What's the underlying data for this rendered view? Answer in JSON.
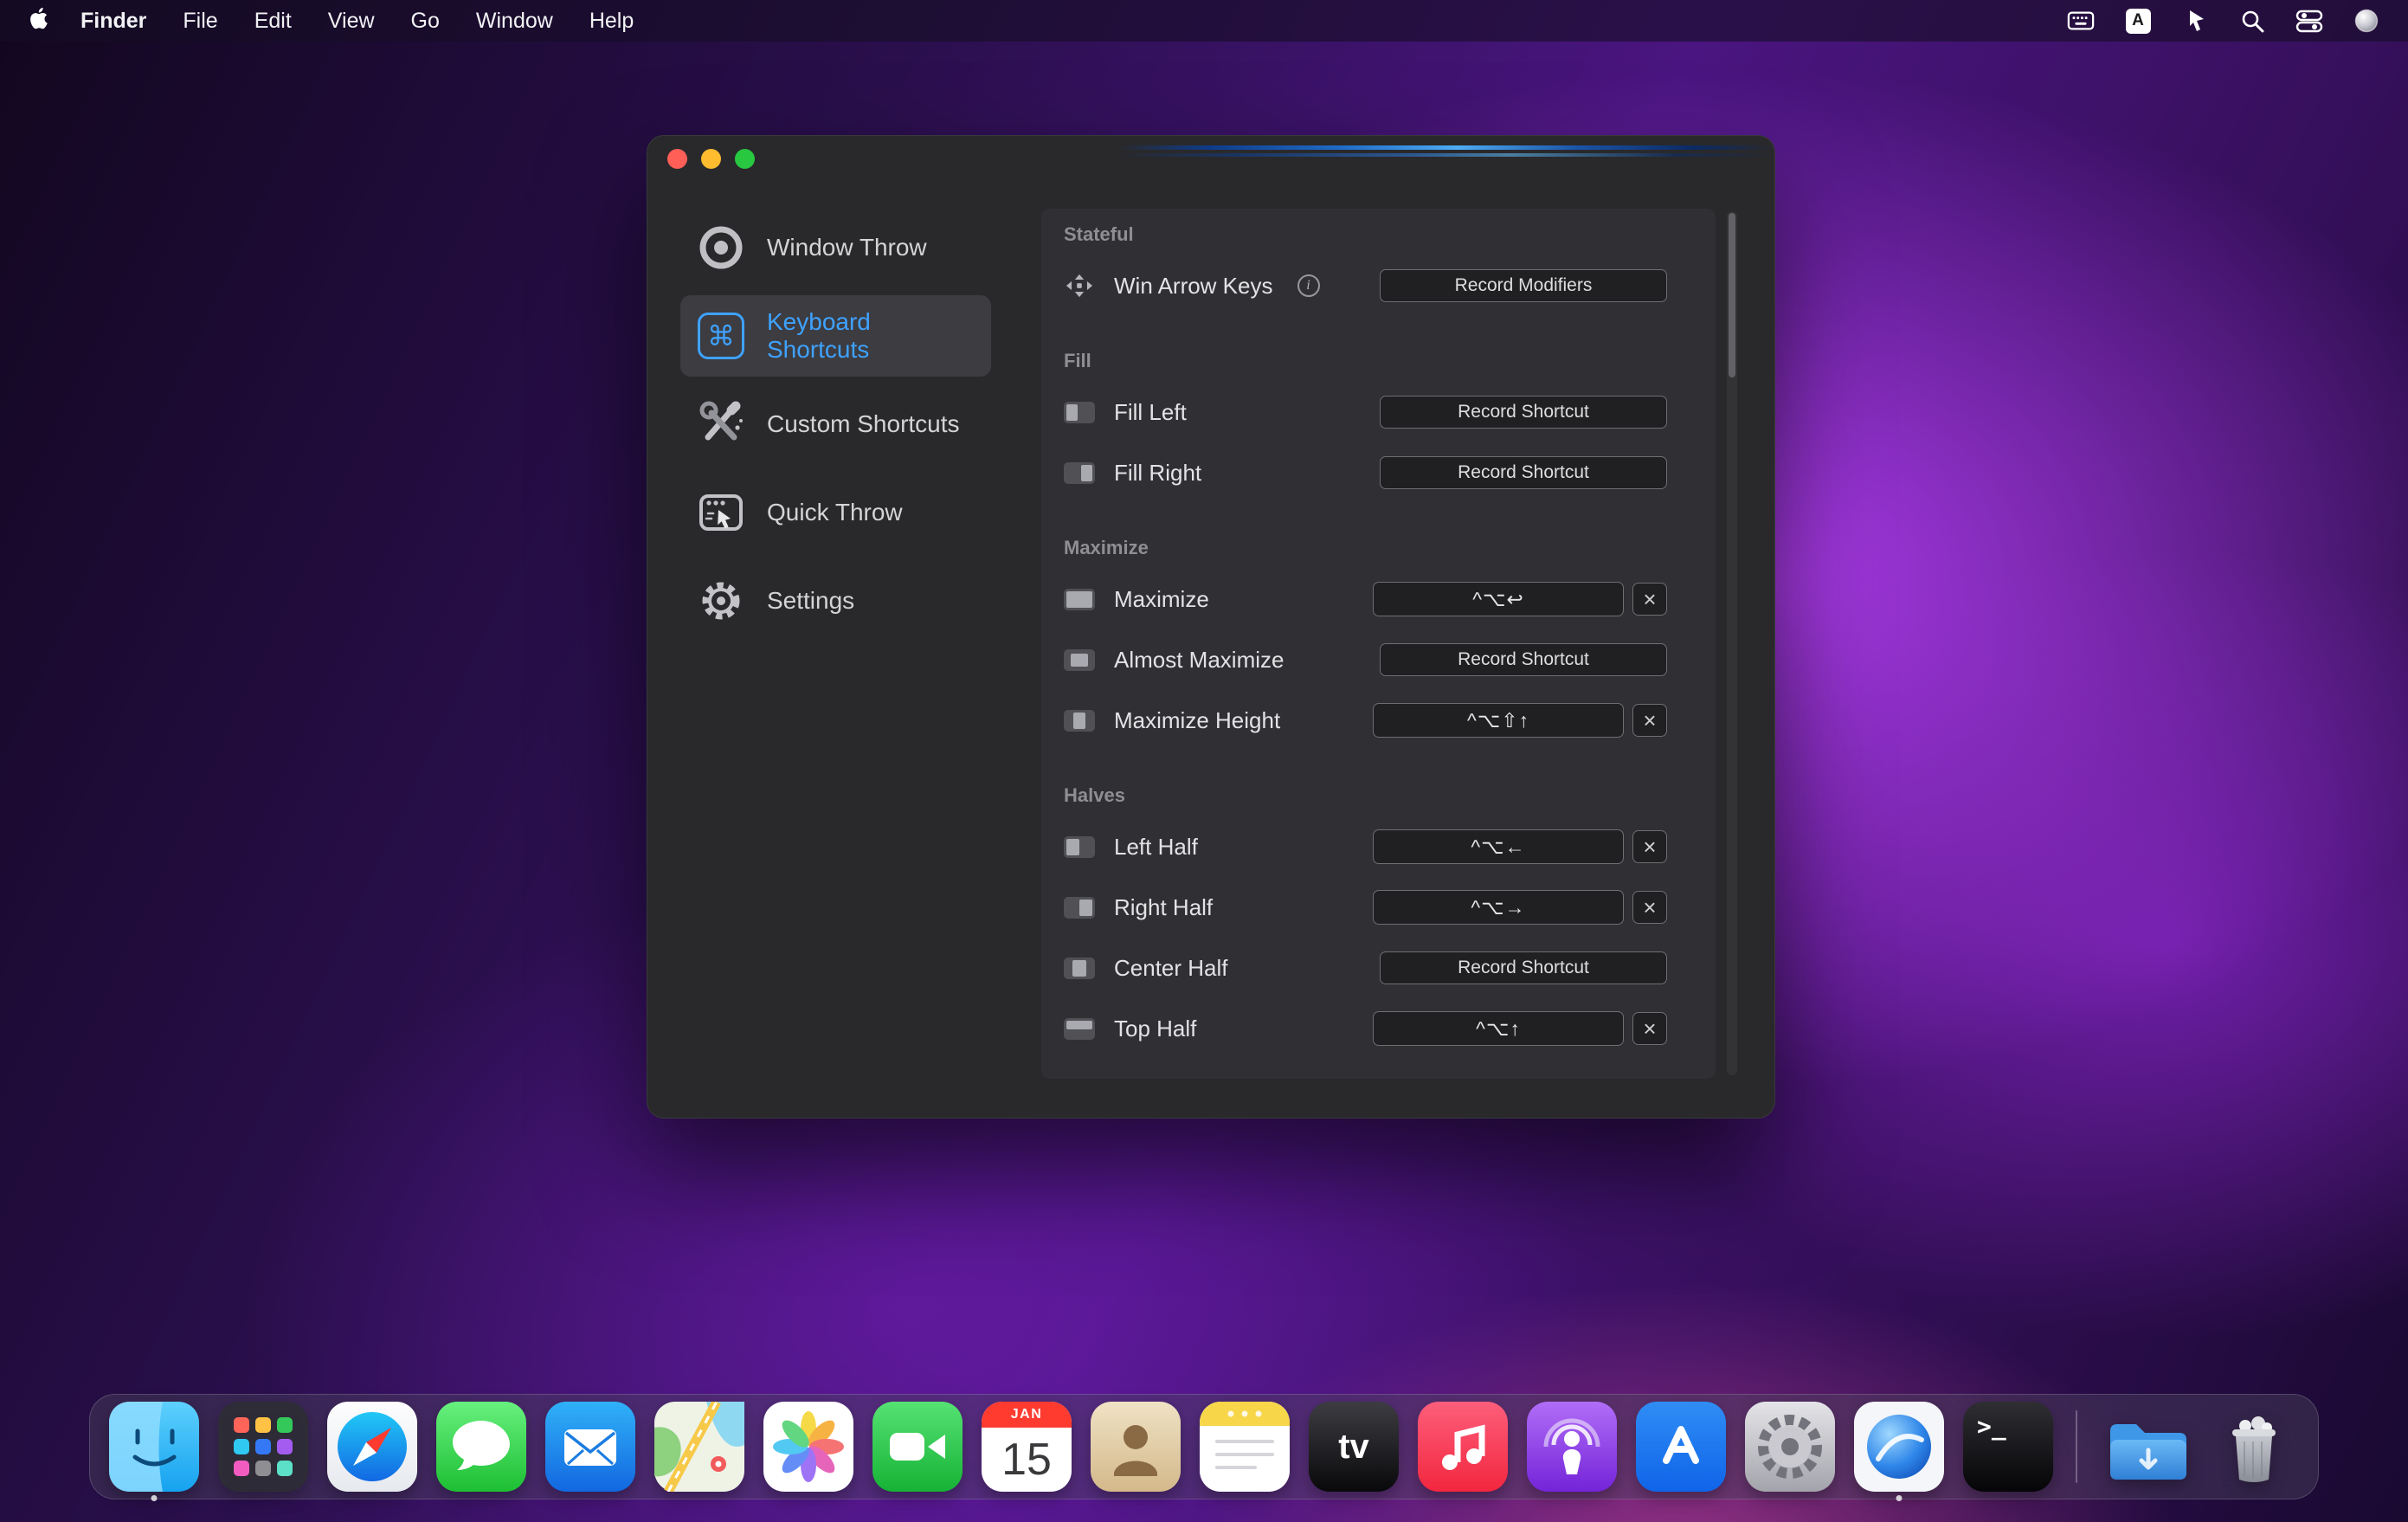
{
  "menu_bar": {
    "app_name": "Finder",
    "menus": [
      "File",
      "Edit",
      "View",
      "Go",
      "Window",
      "Help"
    ]
  },
  "glyphs": {
    "command": "⌘",
    "info": "i",
    "clear": "×",
    "tv": "tv",
    "terminal": ">_",
    "input": "A"
  },
  "window": {
    "sidebar": {
      "items": [
        {
          "label": "Window Throw"
        },
        {
          "label": "Keyboard Shortcuts"
        },
        {
          "label": "Custom Shortcuts"
        },
        {
          "label": "Quick Throw"
        },
        {
          "label": "Settings"
        }
      ]
    },
    "content": {
      "sections": [
        {
          "title": "Stateful",
          "rows": [
            {
              "label": "Win Arrow Keys",
              "button": "Record Modifiers"
            }
          ]
        },
        {
          "title": "Fill",
          "rows": [
            {
              "label": "Fill Left",
              "button": "Record Shortcut"
            },
            {
              "label": "Fill Right",
              "button": "Record Shortcut"
            }
          ]
        },
        {
          "title": "Maximize",
          "rows": [
            {
              "label": "Maximize",
              "shortcut": "^⌥↩"
            },
            {
              "label": "Almost Maximize",
              "button": "Record Shortcut"
            },
            {
              "label": "Maximize Height",
              "shortcut": "^⌥⇧↑"
            }
          ]
        },
        {
          "title": "Halves",
          "rows": [
            {
              "label": "Left Half",
              "shortcut": "^⌥←"
            },
            {
              "label": "Right Half",
              "shortcut": "^⌥→"
            },
            {
              "label": "Center Half",
              "button": "Record Shortcut"
            },
            {
              "label": "Top Half",
              "shortcut": "^⌥↑"
            }
          ]
        }
      ]
    }
  },
  "dock": {
    "calendar": {
      "month": "JAN",
      "day": "15"
    },
    "apps": [
      "Finder",
      "Launchpad",
      "Safari",
      "Messages",
      "Mail",
      "Maps",
      "Photos",
      "FaceTime",
      "Calendar",
      "Contacts",
      "Notes",
      "TV",
      "Music",
      "Podcasts",
      "App Store",
      "System Preferences",
      "Window Manager",
      "Terminal",
      "Downloads",
      "Trash"
    ]
  },
  "colors": {
    "accent_blue": "#3fa2ff",
    "selected_bg": "#3c3c41"
  }
}
